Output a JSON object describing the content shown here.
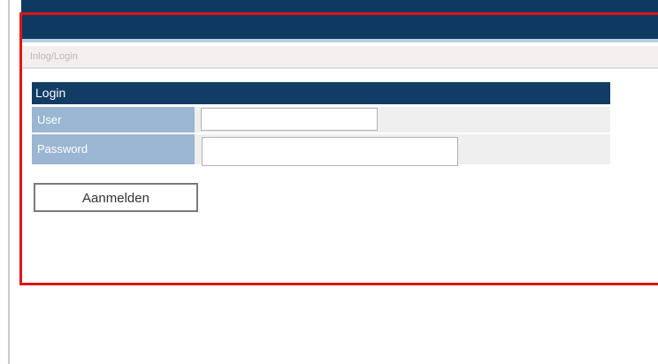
{
  "breadcrumb": {
    "text": "Inlog/Login"
  },
  "login": {
    "header": "Login",
    "user_label": "User",
    "user_value": "",
    "password_label": "Password",
    "password_value": "",
    "submit_label": "Aanmelden"
  },
  "colors": {
    "header_bar": "#0e3a62",
    "panel_header": "#123c66",
    "label_cell": "#9ab6d2",
    "highlight_frame": "#e01515"
  }
}
